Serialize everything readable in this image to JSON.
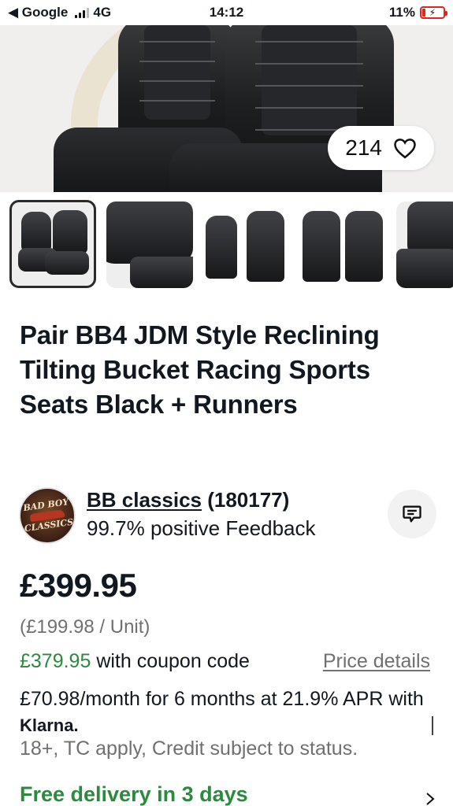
{
  "status_bar": {
    "back_label": "◀ Google",
    "network": "4G",
    "time": "14:12",
    "battery": "11%"
  },
  "gallery": {
    "watch_count": "214",
    "thumbnails": [
      "thumb-1",
      "thumb-2",
      "thumb-3",
      "thumb-4",
      "thumb-5"
    ],
    "selected_index": 0
  },
  "listing": {
    "title": "Pair BB4 JDM Style Reclining Tilting Bucket Racing Sports Seats Black + Runners"
  },
  "seller": {
    "logo_text_top": "BAD BOY",
    "logo_text_bottom": "CLASSICS",
    "name": "BB classics",
    "feedback_count": "(180177)",
    "feedback": "99.7% positive Feedback"
  },
  "pricing": {
    "price": "£399.95",
    "unit_price": "(£199.98 / Unit)",
    "coupon_price": "£379.95",
    "coupon_text": " with coupon code",
    "price_details": "Price details",
    "klarna_text": "£70.98/month for 6 months at 21.9% APR with ",
    "klarna_brand": "Klarna.",
    "credit_text": "18+, TC apply, Credit subject to status."
  },
  "delivery": {
    "label": "Free delivery in 3 days"
  },
  "colors": {
    "green": "#2b8a3e",
    "text": "#111820",
    "muted": "#707070",
    "battery_low": "#e0261f"
  }
}
